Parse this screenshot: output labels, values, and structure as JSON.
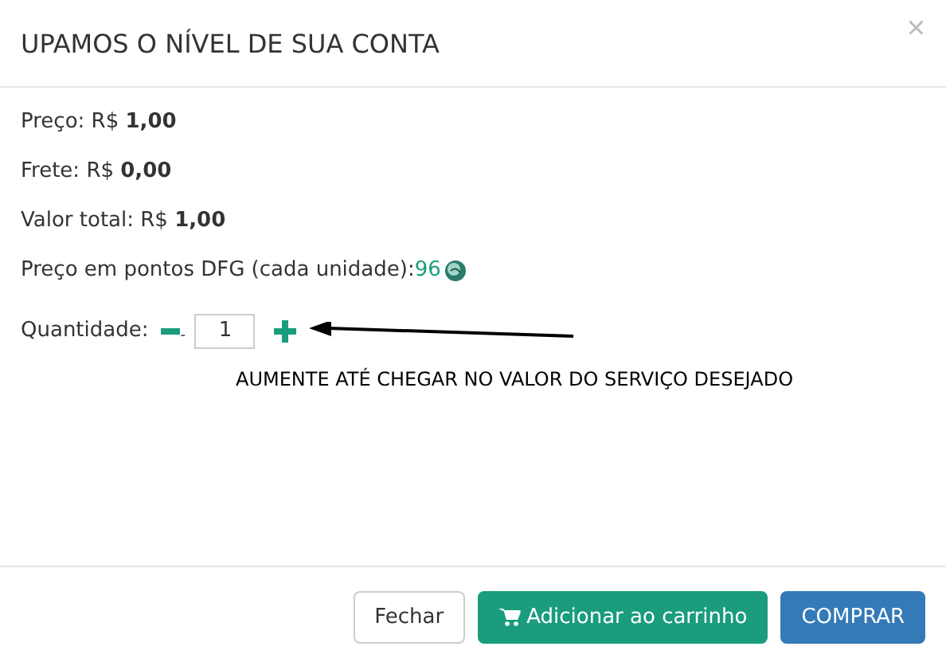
{
  "dialog": {
    "title": "UPAMOS O NÍVEL DE SUA CONTA",
    "close": "×"
  },
  "lines": [
    {
      "label": "Preço: R$ ",
      "value": "1,00"
    },
    {
      "label": "Frete: R$ ",
      "value": "0,00"
    },
    {
      "label": "Valor total: R$ ",
      "value": "1,00"
    }
  ],
  "points": {
    "label": "Preço em pontos DFG (cada unidade): ",
    "value": "96"
  },
  "quantity": {
    "label": "Quantidade:",
    "minus_mark": "-",
    "value": "1"
  },
  "annotation": "AUMENTE ATÉ CHEGAR NO VALOR DO SERVIÇO DESEJADO",
  "buttons": [
    {
      "label": "Fechar",
      "kind": "default"
    },
    {
      "label": "Adicionar ao carrinho",
      "kind": "cart"
    },
    {
      "label": "COMPRAR",
      "kind": "primary"
    }
  ]
}
